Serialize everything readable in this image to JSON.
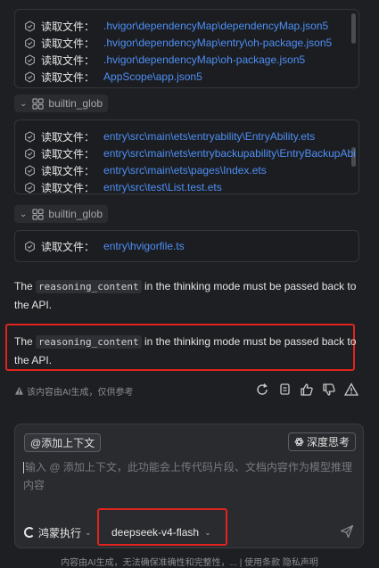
{
  "box1": {
    "rows": [
      {
        "label": "读取文件：",
        "path": ".hvigor\\dependencyMap\\dependencyMap.json5"
      },
      {
        "label": "读取文件：",
        "path": ".hvigor\\dependencyMap\\entry\\oh-package.json5"
      },
      {
        "label": "读取文件：",
        "path": ".hvigor\\dependencyMap\\oh-package.json5"
      },
      {
        "label": "读取文件：",
        "path": "AppScope\\app.json5"
      }
    ]
  },
  "tool1": {
    "label": "builtin_glob"
  },
  "box2": {
    "rows": [
      {
        "label": "读取文件：",
        "path": "entry\\src\\main\\ets\\entryability\\EntryAbility.ets"
      },
      {
        "label": "读取文件：",
        "path": "entry\\src\\main\\ets\\entrybackupability\\EntryBackupAbi"
      },
      {
        "label": "读取文件：",
        "path": "entry\\src\\main\\ets\\pages\\Index.ets"
      },
      {
        "label": "读取文件：",
        "path": "entry\\src\\test\\List.test.ets"
      }
    ]
  },
  "tool2": {
    "label": "builtin_glob"
  },
  "box3": {
    "rows": [
      {
        "label": "读取文件：",
        "path": "entry\\hvigorfile.ts"
      }
    ]
  },
  "para1": {
    "pre": "The ",
    "code": "reasoning_content",
    "post": " in the thinking mode must be passed back to the API."
  },
  "para2": {
    "pre": "The ",
    "code": "reasoning_content",
    "post": " in the thinking mode must be passed back to the API."
  },
  "disclaimer": "该内容由AI生成，仅供参考",
  "input": {
    "context_button": "@添加上下文",
    "deep_think_button": "深度思考",
    "placeholder": "输入 @ 添加上下文，此功能会上传代码片段、文档内容作为模型推理内容",
    "mode": "鸿蒙执行",
    "model": "deepseek-v4-flash"
  },
  "footer": "内容由AI生成，无法确保准确性和完整性，... | 使用条款   隐私声明",
  "colors": {
    "accent": "#4d8ff5",
    "highlight": "#e0241d",
    "background": "#1e1f22"
  }
}
